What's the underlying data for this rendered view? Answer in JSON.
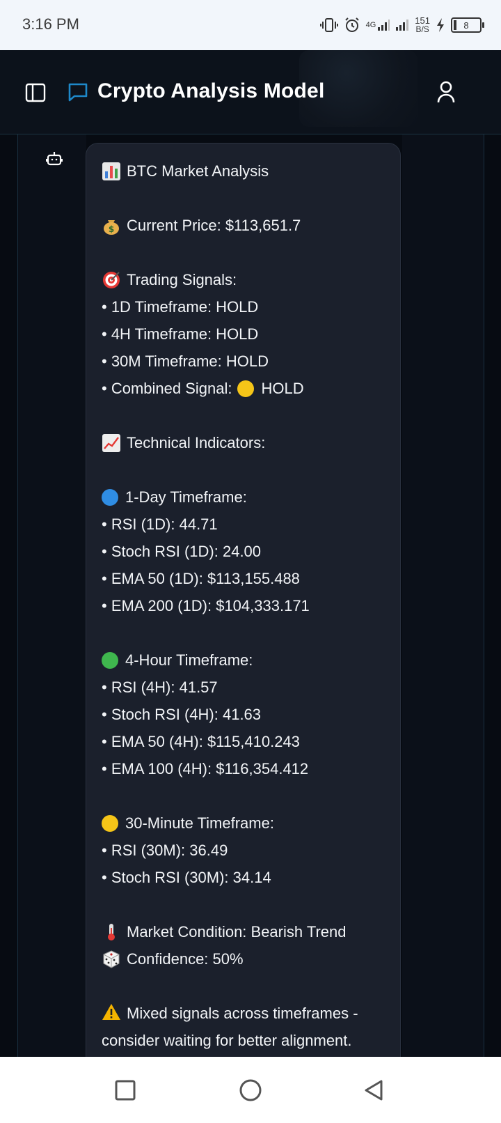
{
  "status_bar": {
    "time": "3:16 PM",
    "network": "4G",
    "speed_value": "151",
    "speed_unit": "B/S",
    "battery": "8"
  },
  "header": {
    "title": "Crypto Analysis Model"
  },
  "message": {
    "title": "BTC Market Analysis",
    "price": "Current Price: $113,651.7",
    "signals_heading": "Trading Signals:",
    "signals": [
      "• 1D Timeframe: HOLD",
      "• 4H Timeframe: HOLD",
      "• 30M Timeframe: HOLD"
    ],
    "combined_prefix": "• Combined Signal:",
    "combined_value": "HOLD",
    "indicators_heading": "Technical Indicators:",
    "day_heading": "1-Day Timeframe:",
    "day_items": [
      "• RSI (1D): 44.71",
      "• Stoch RSI (1D): 24.00",
      "• EMA 50 (1D): $113,155.488",
      "• EMA 200 (1D): $104,333.171"
    ],
    "hour_heading": "4-Hour Timeframe:",
    "hour_items": [
      "• RSI (4H): 41.57",
      "• Stoch RSI (4H): 41.63",
      "• EMA 50 (4H): $115,410.243",
      "• EMA 100 (4H): $116,354.412"
    ],
    "min_heading": "30-Minute Timeframe:",
    "min_items": [
      "• RSI (30M): 36.49",
      "• Stoch RSI (30M): 34.14"
    ],
    "condition": "Market Condition: Bearish Trend",
    "confidence": "Confidence: 50%",
    "warning": "Mixed signals across timeframes - consider waiting for better alignment."
  },
  "colors": {
    "accent": "#1e88c9",
    "bubble_bg": "#1b202c",
    "page_bg": "#070b12"
  }
}
